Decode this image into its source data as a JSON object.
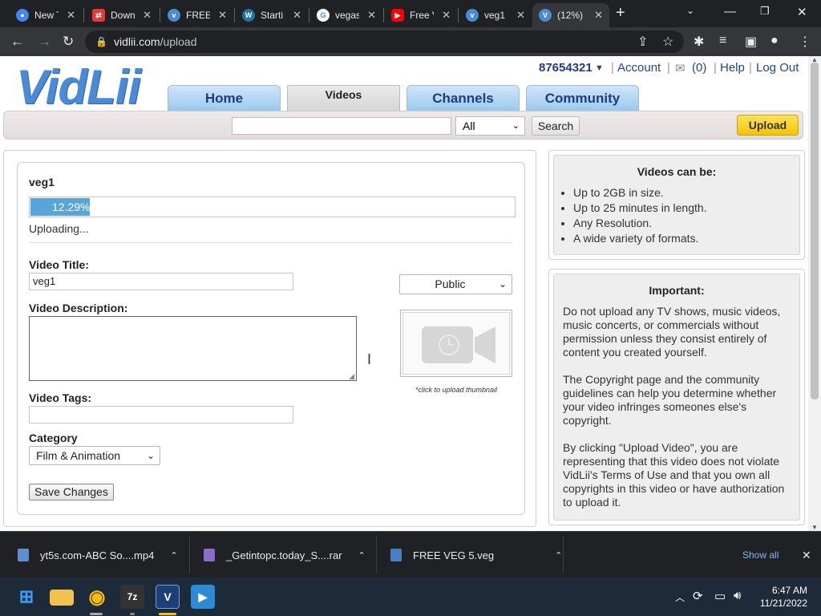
{
  "browser": {
    "tabs": [
      {
        "title": "New Tab",
        "icon": "chrome-icon",
        "color": "#4285f4"
      },
      {
        "title": "Down",
        "icon": "download-site-icon",
        "color": "#e53935"
      },
      {
        "title": "FREE",
        "icon": "vidlii-icon",
        "color": "#4b8bd6"
      },
      {
        "title": "Starti",
        "icon": "wordpress-icon",
        "color": "#21759b"
      },
      {
        "title": "vegas",
        "icon": "google-icon",
        "color": "#ffffff"
      },
      {
        "title": "Free V",
        "icon": "youtube-icon",
        "color": "#ff0000"
      },
      {
        "title": "veg1",
        "icon": "vidlii-icon",
        "color": "#4b8bd6"
      },
      {
        "title": "(12%)",
        "icon": "vidlii-icon",
        "color": "#4b8bd6"
      }
    ],
    "url_domain": "vidlii.com",
    "url_path": "/upload"
  },
  "site": {
    "logo": "VidLii",
    "user": "87654321",
    "account": "Account",
    "inbox": "(0)",
    "help": "Help",
    "logout": "Log Out",
    "nav": [
      "Home",
      "Videos",
      "Channels",
      "Community"
    ],
    "search_scope": "All",
    "search_button": "Search",
    "upload_button": "Upload"
  },
  "upload": {
    "filename": "veg1",
    "progress_percent": 12.29,
    "progress_label": "12.29%",
    "status": "Uploading...",
    "title_label": "Video Title:",
    "title_value": "veg1",
    "privacy": "Public",
    "description_label": "Video Description:",
    "description_value": "",
    "thumbnail_caption": "*click to upload thumbnail",
    "tags_label": "Video Tags:",
    "tags_value": "",
    "category_label": "Category",
    "category_value": "Film & Animation",
    "save_button": "Save Changes"
  },
  "sidebar": {
    "videos_title": "Videos can be:",
    "videos_items": [
      "Up to 2GB in size.",
      "Up to 25 minutes in length.",
      "Any Resolution.",
      "A wide variety of formats."
    ],
    "important_title": "Important:",
    "important_paragraphs": [
      "Do not upload any TV shows, music videos, music concerts, or commercials without permission unless they consist entirely of content you created yourself.",
      "The Copyright page and the community guidelines can help you determine whether your video infringes someones else's copyright.",
      "By clicking \"Upload Video\", you are representing that this video does not violate VidLii's Terms of Use and that you own all copyrights in this video or have authorization to upload it."
    ]
  },
  "downloads": {
    "items": [
      "yt5s.com-ABC So....mp4",
      "_Getintopc.today_S....rar",
      "FREE VEG 5.veg"
    ],
    "show_all": "Show all"
  },
  "taskbar": {
    "time": "6:47 AM",
    "date": "11/21/2022"
  }
}
